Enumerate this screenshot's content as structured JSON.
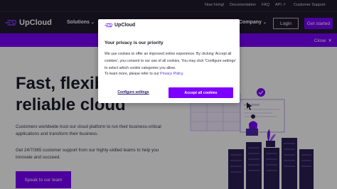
{
  "topbar": {
    "links": [
      "Now hiring!",
      "Documentation",
      "FAQ",
      "API",
      "Customer Support"
    ]
  },
  "header": {
    "logo_text": "UpCloud",
    "nav_solutions": "Solutions",
    "nav_company": "Company",
    "login_label": "Login",
    "get_started_label": "Get started"
  },
  "strip": {
    "close_label": "Close"
  },
  "hero": {
    "title_line1": "Fast, flexible and",
    "title_line2": "reliable cloud",
    "paragraph1": "Customers worldwide trust our cloud platform to run their business-critical applications and transform their business.",
    "paragraph2": "Get 24/7/365 customer support from our highly-skilled teams to help you innovate and succeed.",
    "cta_label": "Speak to our team"
  },
  "modal": {
    "logo_text": "UpCloud",
    "title": "Your privacy is our priority",
    "body": "We use cookies to offer an improved online experience. By clicking 'Accept all cookies', you consent to our use of all cookies. You may click 'Configure settings' to select which cookie categories you allow.",
    "learn_more_prefix": "To learn more, please refer to our ",
    "privacy_link": "Privacy Policy",
    "learn_more_suffix": ".",
    "configure_label": "Configure settings",
    "accept_label": "Accept all cookies"
  },
  "colors": {
    "brand_purple": "#7b00ff",
    "header_dark": "#1f1b2e"
  }
}
